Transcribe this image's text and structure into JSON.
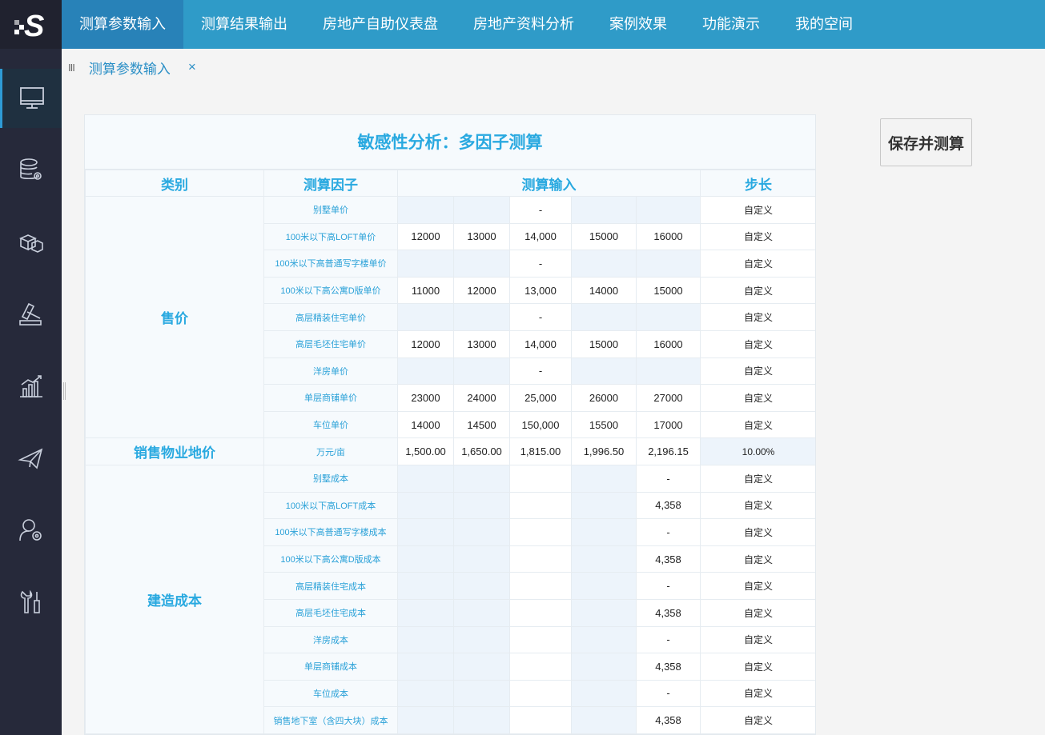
{
  "logo": "S",
  "nav": [
    "测算参数输入",
    "测算结果输出",
    "房地产自助仪表盘",
    "房地产资料分析",
    "案例效果",
    "功能演示",
    "我的空间"
  ],
  "tab": {
    "handle": "III",
    "label": "测算参数输入",
    "close": "×"
  },
  "save_button": "保存并测算",
  "sidebar_icons": [
    "monitor-icon",
    "database-gear-icon",
    "cubes-icon",
    "gavel-icon",
    "bar-chart-icon",
    "paper-plane-icon",
    "user-gear-icon",
    "tools-icon"
  ],
  "table": {
    "title": "敏感性分析：多因子测算",
    "headers": {
      "category": "类别",
      "factor": "测算因子",
      "input": "测算输入",
      "step": "步长"
    },
    "groups": [
      {
        "category": "售价",
        "rows": [
          {
            "factor": "别墅单价",
            "values": [
              "",
              "",
              "-",
              "",
              ""
            ],
            "step": "自定义"
          },
          {
            "factor": "100米以下高LOFT单价",
            "values": [
              "12000",
              "13000",
              "14,000",
              "15000",
              "16000"
            ],
            "step": "自定义"
          },
          {
            "factor": "100米以下高普通写字楼单价",
            "values": [
              "",
              "",
              "-",
              "",
              ""
            ],
            "step": "自定义"
          },
          {
            "factor": "100米以下高公寓D版单价",
            "values": [
              "11000",
              "12000",
              "13,000",
              "14000",
              "15000"
            ],
            "step": "自定义"
          },
          {
            "factor": "高层精装住宅单价",
            "values": [
              "",
              "",
              "-",
              "",
              ""
            ],
            "step": "自定义"
          },
          {
            "factor": "高层毛坯住宅单价",
            "values": [
              "12000",
              "13000",
              "14,000",
              "15000",
              "16000"
            ],
            "step": "自定义"
          },
          {
            "factor": "洋房单价",
            "values": [
              "",
              "",
              "-",
              "",
              ""
            ],
            "step": "自定义"
          },
          {
            "factor": "单层商铺单价",
            "values": [
              "23000",
              "24000",
              "25,000",
              "26000",
              "27000"
            ],
            "step": "自定义"
          },
          {
            "factor": "车位单价",
            "values": [
              "14000",
              "14500",
              "150,000",
              "15500",
              "17000"
            ],
            "step": "自定义"
          }
        ]
      },
      {
        "category": "销售物业地价",
        "rows": [
          {
            "factor": "万元/亩",
            "values": [
              "1,500.00",
              "1,650.00",
              "1,815.00",
              "1,996.50",
              "2,196.15"
            ],
            "step": "10.00%"
          }
        ]
      },
      {
        "category": "建造成本",
        "rows": [
          {
            "factor": "别墅成本",
            "values": [
              "",
              "",
              "",
              "",
              "-"
            ],
            "step": "自定义"
          },
          {
            "factor": "100米以下高LOFT成本",
            "values": [
              "",
              "",
              "",
              "",
              "4,358"
            ],
            "step": "自定义"
          },
          {
            "factor": "100米以下高普通写字楼成本",
            "values": [
              "",
              "",
              "",
              "",
              "-"
            ],
            "step": "自定义"
          },
          {
            "factor": "100米以下高公寓D版成本",
            "values": [
              "",
              "",
              "",
              "",
              "4,358"
            ],
            "step": "自定义"
          },
          {
            "factor": "高层精装住宅成本",
            "values": [
              "",
              "",
              "",
              "",
              "-"
            ],
            "step": "自定义"
          },
          {
            "factor": "高层毛坯住宅成本",
            "values": [
              "",
              "",
              "",
              "",
              "4,358"
            ],
            "step": "自定义"
          },
          {
            "factor": "洋房成本",
            "values": [
              "",
              "",
              "",
              "",
              "-"
            ],
            "step": "自定义"
          },
          {
            "factor": "单层商铺成本",
            "values": [
              "",
              "",
              "",
              "",
              "4,358"
            ],
            "step": "自定义"
          },
          {
            "factor": "车位成本",
            "values": [
              "",
              "",
              "",
              "",
              "-"
            ],
            "step": "自定义"
          },
          {
            "factor": "销售地下室（含四大块）成本",
            "values": [
              "",
              "",
              "",
              "",
              "4,358"
            ],
            "step": "自定义"
          }
        ]
      }
    ]
  }
}
